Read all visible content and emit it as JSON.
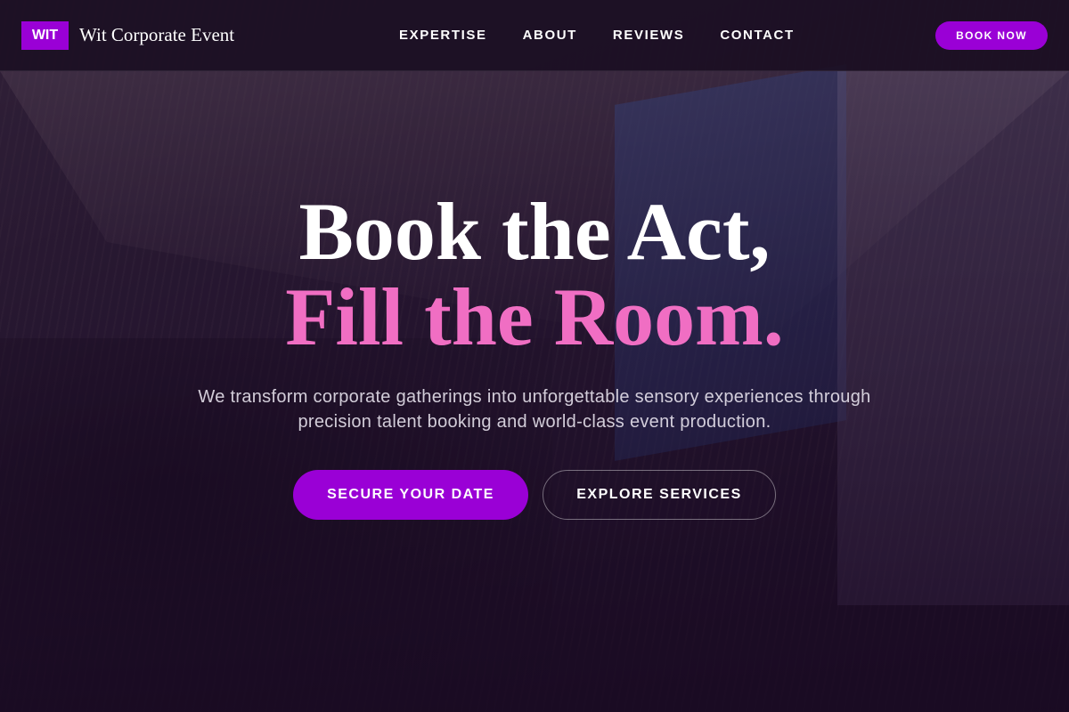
{
  "nav": {
    "brand_badge": "WIT",
    "brand_name": "Wit Corporate Event",
    "links": [
      "EXPERTISE",
      "ABOUT",
      "REVIEWS",
      "CONTACT"
    ],
    "cta_label": "BOOK NOW"
  },
  "hero": {
    "headline_line1": "Book the Act,",
    "headline_line2": "Fill the Room.",
    "subtitle": "We transform corporate gatherings into unforgettable sensory experiences through precision talent booking and world-class event production.",
    "primary_button": "SECURE YOUR DATE",
    "secondary_button": "EXPLORE SERVICES"
  },
  "colors": {
    "accent": "#9a00d6",
    "headline_highlight": "#f06ec3",
    "nav_background": "#1c1024"
  }
}
